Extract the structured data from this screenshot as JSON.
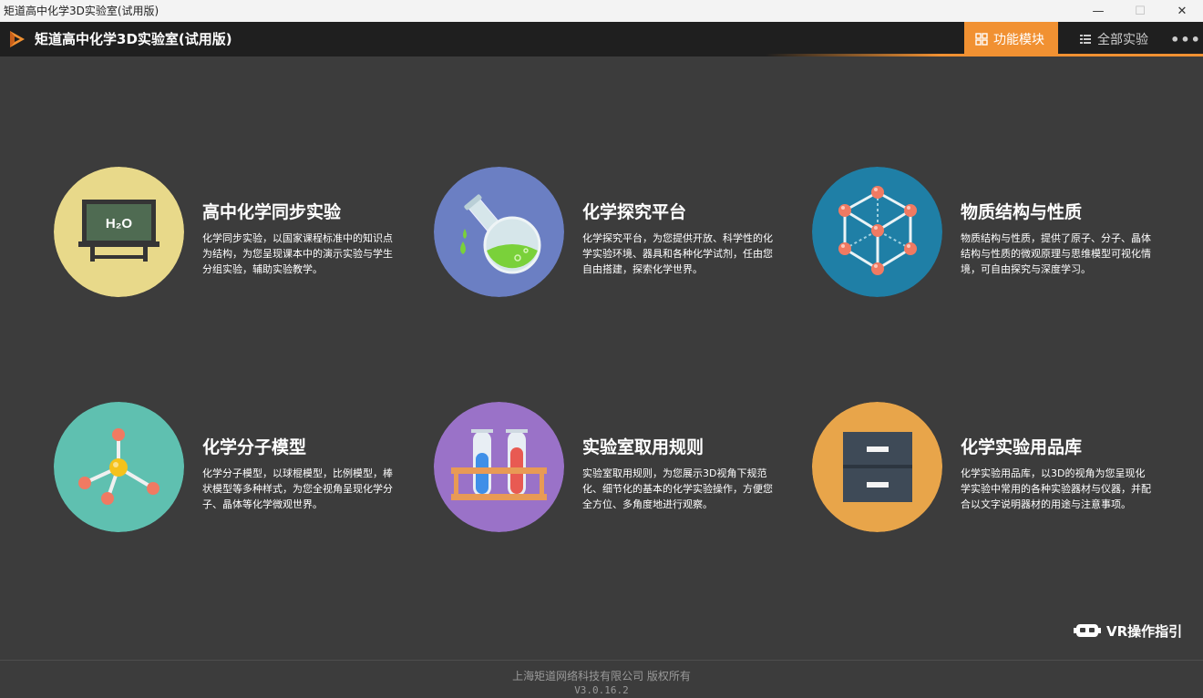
{
  "window": {
    "title": "矩道高中化学3D实验室(试用版)",
    "minimize_glyph": "—",
    "maximize_glyph": "☐",
    "close_glyph": "✕"
  },
  "header": {
    "app_title": "矩道高中化学3D实验室(试用版)",
    "logo_icon": "play-logo-icon",
    "tabs": [
      {
        "label": "功能模块",
        "icon": "grid-icon",
        "active": true
      },
      {
        "label": "全部实验",
        "icon": "list-icon",
        "active": false
      }
    ],
    "more_glyph": "•••"
  },
  "modules": [
    {
      "title": "高中化学同步实验",
      "description": "化学同步实验，以国家课程标准中的知识点为结构，为您呈现课本中的演示实验与学生分组实验，辅助实验教学。",
      "icon": "blackboard-icon",
      "board_text": "H₂O",
      "color": "#e8d98a"
    },
    {
      "title": "化学探究平台",
      "description": "化学探究平台，为您提供开放、科学性的化学实验环境、器具和各种化学试剂，任由您自由搭建，探索化学世界。",
      "icon": "flask-icon",
      "color": "#6b7fc3"
    },
    {
      "title": "物质结构与性质",
      "description": "物质结构与性质，提供了原子、分子、晶体结构与性质的微观原理与思维模型可视化情境，可自由探究与深度学习。",
      "icon": "crystal-structure-icon",
      "color": "#1f7fa6"
    },
    {
      "title": "化学分子模型",
      "description": "化学分子模型，以球棍模型，比例模型，棒状模型等多种样式，为您全视角呈现化学分子、晶体等化学微观世界。",
      "icon": "molecule-icon",
      "color": "#5fc0b0"
    },
    {
      "title": "实验室取用规则",
      "description": "实验室取用规则，为您展示3D视角下规范化、细节化的基本的化学实验操作，方便您全方位、多角度地进行观察。",
      "icon": "test-tubes-icon",
      "color": "#9a72c8"
    },
    {
      "title": "化学实验用品库",
      "description": "化学实验用品库，以3D的视角为您呈现化学实验中常用的各种实验器材与仪器，并配合以文字说明器材的用途与注意事项。",
      "icon": "cabinet-icon",
      "color": "#e8a54a"
    }
  ],
  "vr_guide": {
    "label": "VR操作指引",
    "icon": "vr-headset-icon"
  },
  "footer": {
    "copyright": "上海矩道网络科技有限公司  版权所有",
    "version": "V3.0.16.2"
  },
  "colors": {
    "accent": "#f19132",
    "background": "#3c3c3c",
    "header": "#1f1f1f"
  }
}
